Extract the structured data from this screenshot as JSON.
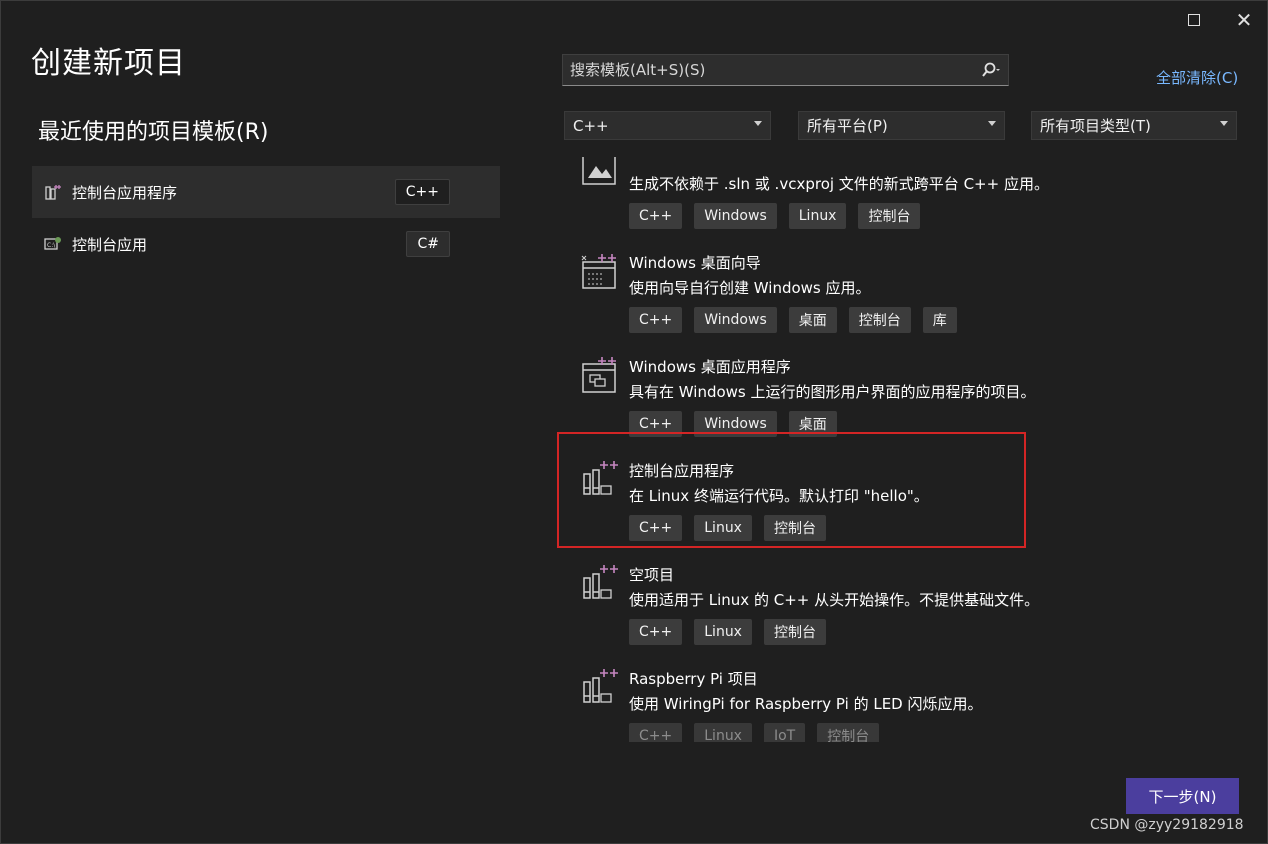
{
  "window": {
    "maximize_icon": "maximize-icon",
    "close_icon": "close-icon"
  },
  "page_title": "创建新项目",
  "recent": {
    "title": "最近使用的项目模板(R)",
    "items": [
      {
        "label": "控制台应用程序",
        "tag": "C++",
        "icon": "console-app-icon",
        "selected": true
      },
      {
        "label": "控制台应用",
        "tag": "C#",
        "icon": "console-app-csharp-icon",
        "selected": false
      }
    ]
  },
  "search": {
    "placeholder": "搜索模板(Alt+S)(S)",
    "value": ""
  },
  "clear_all": "全部清除(C)",
  "filters": {
    "language": "C++",
    "platform": "所有平台(P)",
    "project_type": "所有项目类型(T)"
  },
  "templates": [
    {
      "name": "",
      "desc": "生成不依赖于 .sln 或 .vcxproj 文件的新式跨平台 C++ 应用。",
      "tags": [
        "C++",
        "Windows",
        "Linux",
        "控制台"
      ],
      "icon": "cmake-project-icon"
    },
    {
      "name": "Windows 桌面向导",
      "desc": "使用向导自行创建 Windows 应用。",
      "tags": [
        "C++",
        "Windows",
        "桌面",
        "控制台",
        "库"
      ],
      "icon": "desktop-wizard-icon"
    },
    {
      "name": "Windows 桌面应用程序",
      "desc": "具有在 Windows 上运行的图形用户界面的应用程序的项目。",
      "tags": [
        "C++",
        "Windows",
        "桌面"
      ],
      "icon": "desktop-app-icon"
    },
    {
      "name": "控制台应用程序",
      "desc": "在 Linux 终端运行代码。默认打印 \"hello\"。",
      "tags": [
        "C++",
        "Linux",
        "控制台"
      ],
      "icon": "linux-console-icon"
    },
    {
      "name": "空项目",
      "desc": "使用适用于 Linux 的 C++ 从头开始操作。不提供基础文件。",
      "tags": [
        "C++",
        "Linux",
        "控制台"
      ],
      "icon": "linux-empty-project-icon"
    },
    {
      "name": "Raspberry Pi 项目",
      "desc": "使用 WiringPi for Raspberry Pi 的 LED 闪烁应用。",
      "tags": [
        "C++",
        "Linux",
        "IoT",
        "控制台"
      ],
      "icon": "raspberry-pi-icon"
    }
  ],
  "next_button": "下一步(N)",
  "watermark": "CSDN @zyy29182918",
  "colors": {
    "background": "#1f1f1f",
    "accent_button": "#4b3e9e",
    "selection_frame": "#d32525",
    "link": "#79b8ff"
  }
}
